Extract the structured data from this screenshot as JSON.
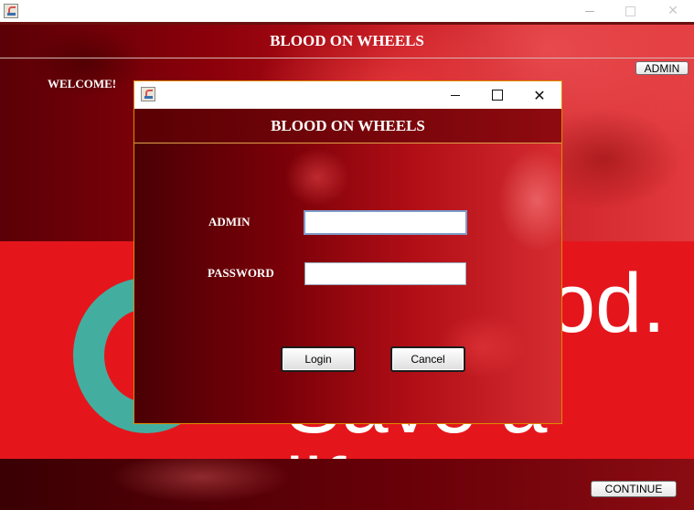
{
  "outer_window": {
    "icon": "java-cup-icon",
    "controls": {
      "minimize": "minimize-icon",
      "maximize": "maximize-icon",
      "close": "✕"
    }
  },
  "background_app": {
    "title": "BLOOD ON WHEELS",
    "welcome": "WELCOME!",
    "admin_button": "ADMIN",
    "banner_line1": "od.",
    "banner_line2": "Save a life.",
    "continue_button": "CONTINUE"
  },
  "dialog": {
    "icon": "java-cup-icon",
    "controls": {
      "minimize": "minimize-icon",
      "maximize": "maximize-icon",
      "close": "✕"
    },
    "header_title": "BLOOD ON WHEELS",
    "admin_label": "ADMIN",
    "admin_value": "",
    "password_label": "PASSWORD",
    "password_value": "",
    "login_button": "Login",
    "cancel_button": "Cancel"
  },
  "colors": {
    "accent_red": "#e4161c",
    "teal": "#43ae9f",
    "dialog_border": "#e08a00"
  }
}
